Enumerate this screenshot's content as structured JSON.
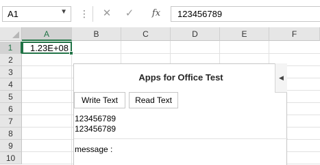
{
  "formula_bar": {
    "name_box": "A1",
    "separator_icon": "more-vertical-icon",
    "cancel_icon": "✕",
    "enter_icon": "✓",
    "fx_label": "fx",
    "value": "123456789"
  },
  "grid": {
    "columns": [
      "A",
      "B",
      "C",
      "D",
      "E",
      "F"
    ],
    "rows": [
      "1",
      "2",
      "3",
      "4",
      "5",
      "6",
      "7",
      "8",
      "9",
      "10"
    ],
    "active_cell_value": "1.23E+08",
    "selected_column": "A",
    "selected_row": "1",
    "accent_color": "#217346"
  },
  "task_pane": {
    "title": "Apps for Office Test",
    "write_button": "Write Text",
    "read_button": "Read Text",
    "line1": "123456789",
    "line2": "123456789",
    "message_label": "message :",
    "toggle_icon": "chevron-left-icon"
  }
}
